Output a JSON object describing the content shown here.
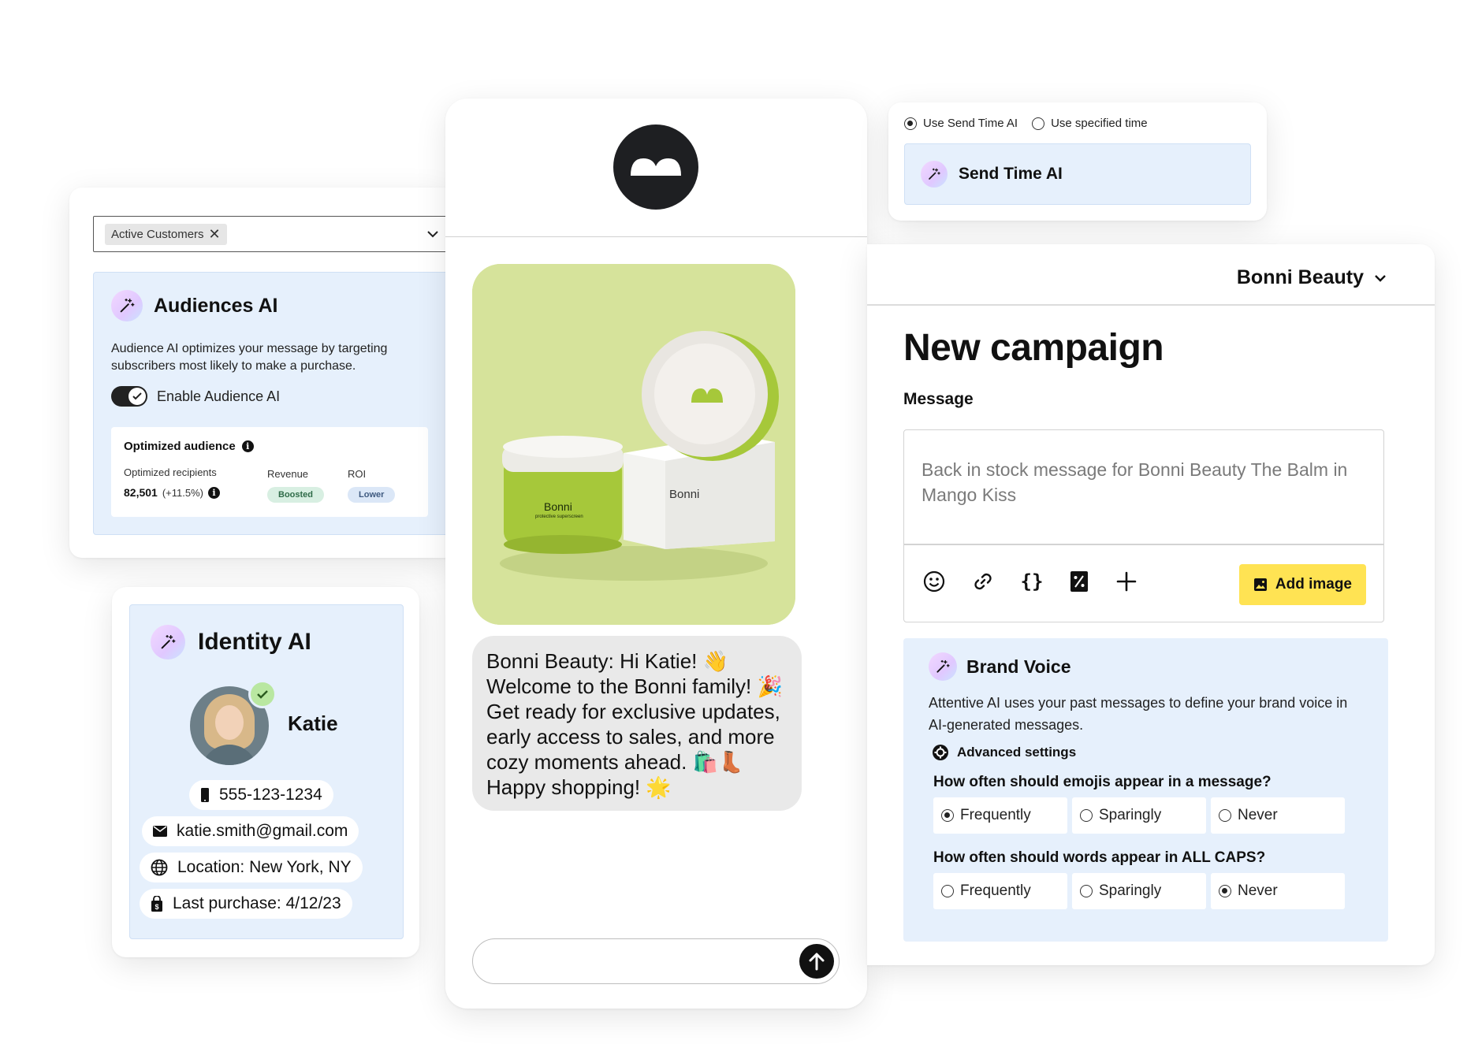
{
  "audiences": {
    "chip_label": "Active Customers",
    "title": "Audiences AI",
    "description": "Audience AI optimizes your message by targeting subscribers most likely to make a purchase.",
    "toggle_label": "Enable Audience AI",
    "toggle_on": true,
    "optimized": {
      "title": "Optimized audience",
      "recipients_label": "Optimized recipients",
      "recipients_value": "82,501",
      "recipients_delta": "(+11.5%)",
      "revenue_label": "Revenue",
      "revenue_badge": "Boosted",
      "roi_label": "ROI",
      "roi_badge": "Lower"
    }
  },
  "identity": {
    "title": "Identity AI",
    "name": "Katie",
    "phone": "555-123-1234",
    "email": "katie.smith@gmail.com",
    "location": "Location: New York, NY",
    "last_purchase": "Last purchase: 4/12/23"
  },
  "phone": {
    "product_brand": "Bonni",
    "product_sub": "protective superscreen",
    "message_lines": [
      "Bonni Beauty: Hi Katie! 👋",
      "Welcome to the Bonni family! 🎉",
      "Get ready for exclusive updates,",
      "early access to sales, and more",
      "cozy moments ahead. 🛍️👢",
      "Happy shopping! 🌟"
    ]
  },
  "send_time": {
    "option_ai": "Use Send Time AI",
    "option_specified": "Use specified time",
    "selected": "ai",
    "title": "Send Time AI"
  },
  "campaign": {
    "brand": "Bonni Beauty",
    "title": "New campaign",
    "message_label": "Message",
    "message_text": "Back in stock message for Bonni Beauty The Balm in Mango Kiss",
    "add_image_label": "Add image",
    "tools": [
      "emoji-icon",
      "link-icon",
      "braces-icon",
      "percent-icon",
      "plus-icon"
    ],
    "accent_color": "#ffe353"
  },
  "brand_voice": {
    "title": "Brand Voice",
    "description": "Attentive AI uses your past messages to define your brand voice in AI-generated messages.",
    "advanced_label": "Advanced settings",
    "q1": "How often should emojis appear in a message?",
    "q1_options": [
      "Frequently",
      "Sparingly",
      "Never"
    ],
    "q1_selected": 0,
    "q2": "How often should words appear in ALL CAPS?",
    "q2_options": [
      "Frequently",
      "Sparingly",
      "Never"
    ],
    "q2_selected": 2
  },
  "colors": {
    "panel_blue": "#e6f0fc",
    "product_green": "#d6e39b",
    "dark": "#1e1f22"
  }
}
